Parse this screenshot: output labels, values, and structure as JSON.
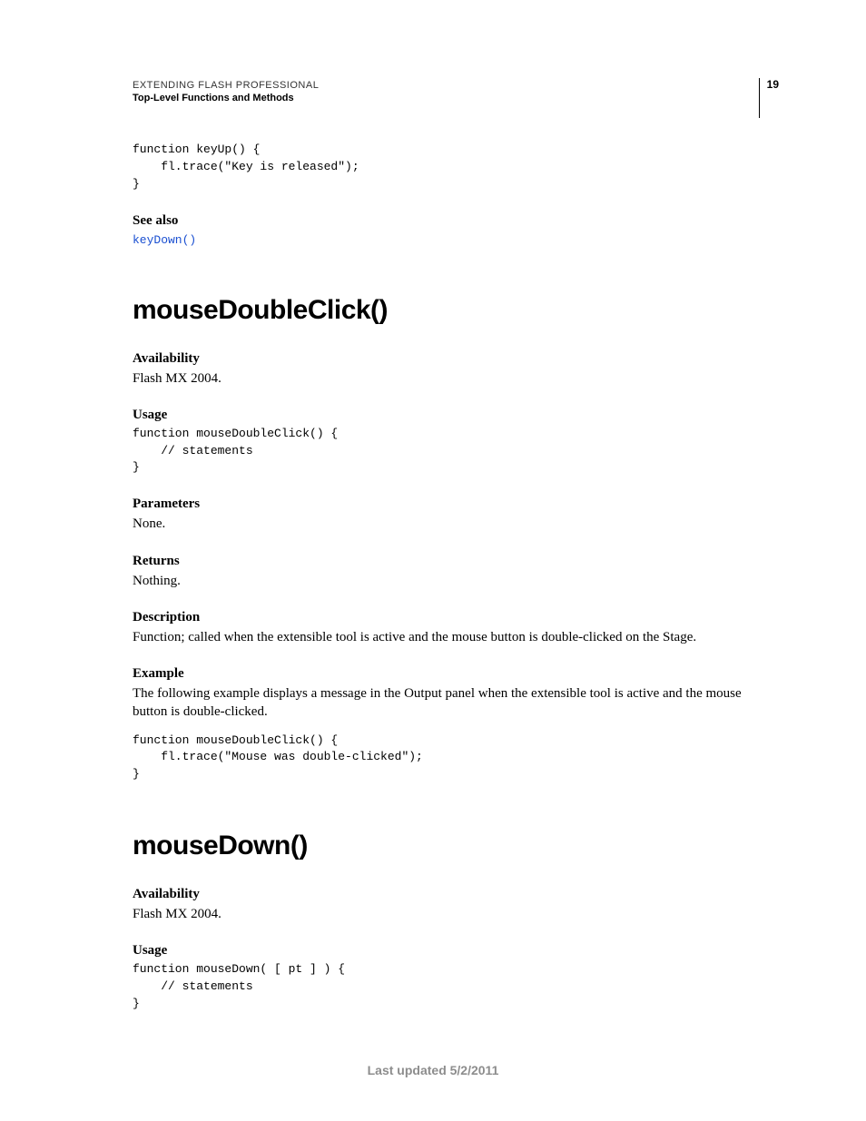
{
  "header": {
    "running": "EXTENDING FLASH PROFESSIONAL",
    "subtitle": "Top-Level Functions and Methods",
    "page_number": "19"
  },
  "intro_code": "function keyUp() {\n    fl.trace(\"Key is released\");\n}",
  "see_also": {
    "label": "See also",
    "link": "keyDown()"
  },
  "fn1": {
    "title": "mouseDoubleClick()",
    "availability_label": "Availability",
    "availability_text": "Flash MX 2004.",
    "usage_label": "Usage",
    "usage_code": "function mouseDoubleClick() {\n    // statements\n}",
    "parameters_label": "Parameters",
    "parameters_text": "None.",
    "returns_label": "Returns",
    "returns_text": "Nothing.",
    "description_label": "Description",
    "description_text": "Function; called when the extensible tool is active and the mouse button is double-clicked on the Stage.",
    "example_label": "Example",
    "example_text": "The following example displays a message in the Output panel when the extensible tool is active and the mouse button is double-clicked.",
    "example_code": "function mouseDoubleClick() {\n    fl.trace(\"Mouse was double-clicked\");\n}"
  },
  "fn2": {
    "title": "mouseDown()",
    "availability_label": "Availability",
    "availability_text": "Flash MX 2004.",
    "usage_label": "Usage",
    "usage_code": "function mouseDown( [ pt ] ) {\n    // statements\n}"
  },
  "footer": {
    "updated": "Last updated 5/2/2011"
  }
}
